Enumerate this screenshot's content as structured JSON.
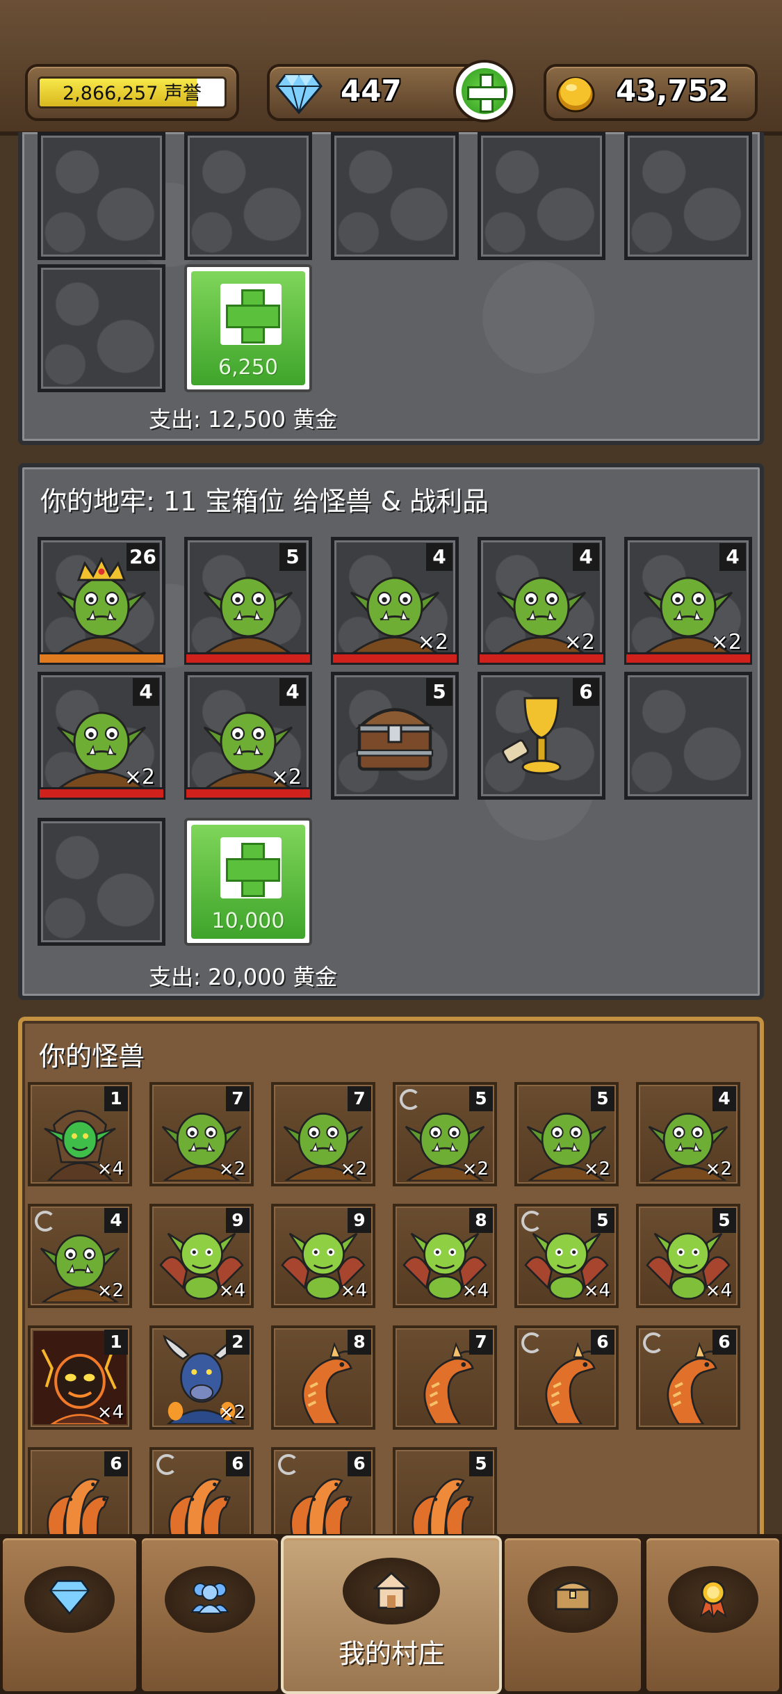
{
  "top_bar": {
    "reputation_text": "2,866,257 声誉",
    "reputation_fill": 0.85,
    "gems": "447",
    "gold": "43,752"
  },
  "panel1": {
    "add_slot_price": "6,250",
    "footer": "支出: 12,500 黄金"
  },
  "panel2": {
    "title": "你的地牢: 11 宝箱位 给怪兽 & 战利品",
    "slots": [
      {
        "num": "26",
        "count": "",
        "type": "orc-king"
      },
      {
        "num": "5",
        "count": "",
        "type": "orc"
      },
      {
        "num": "4",
        "count": "×2",
        "type": "orc"
      },
      {
        "num": "4",
        "count": "×2",
        "type": "orc"
      },
      {
        "num": "4",
        "count": "×2",
        "type": "orc"
      },
      {
        "num": "4",
        "count": "×2",
        "type": "orc"
      },
      {
        "num": "4",
        "count": "×2",
        "type": "orc"
      },
      {
        "num": "5",
        "count": "",
        "type": "chest"
      },
      {
        "num": "6",
        "count": "",
        "type": "goblet"
      }
    ],
    "add_slot_price": "10,000",
    "footer": "支出: 20,000 黄金"
  },
  "monsters": {
    "title": "你的怪兽",
    "items": [
      {
        "num": "1",
        "count": "×4",
        "type": "goblin",
        "refresh": false
      },
      {
        "num": "7",
        "count": "×2",
        "type": "orc",
        "refresh": false
      },
      {
        "num": "7",
        "count": "×2",
        "type": "orc",
        "refresh": false
      },
      {
        "num": "5",
        "count": "×2",
        "type": "orc",
        "refresh": true
      },
      {
        "num": "5",
        "count": "×2",
        "type": "orc",
        "refresh": false
      },
      {
        "num": "4",
        "count": "×2",
        "type": "orc",
        "refresh": false
      },
      {
        "num": "4",
        "count": "×2",
        "type": "orc",
        "refresh": true
      },
      {
        "num": "9",
        "count": "×4",
        "type": "imp",
        "refresh": false
      },
      {
        "num": "9",
        "count": "×4",
        "type": "imp",
        "refresh": false
      },
      {
        "num": "8",
        "count": "×4",
        "type": "imp",
        "refresh": false
      },
      {
        "num": "5",
        "count": "×4",
        "type": "imp",
        "refresh": true
      },
      {
        "num": "5",
        "count": "×4",
        "type": "imp",
        "refresh": false
      },
      {
        "num": "1",
        "count": "×4",
        "type": "fire-demon",
        "refresh": false
      },
      {
        "num": "2",
        "count": "×2",
        "type": "minotaur",
        "refresh": false
      },
      {
        "num": "8",
        "count": "",
        "type": "dragon",
        "refresh": false
      },
      {
        "num": "7",
        "count": "",
        "type": "dragon",
        "refresh": false
      },
      {
        "num": "6",
        "count": "",
        "type": "dragon",
        "refresh": true
      },
      {
        "num": "6",
        "count": "",
        "type": "dragon",
        "refresh": true
      },
      {
        "num": "6",
        "count": "",
        "type": "hydra",
        "refresh": false
      },
      {
        "num": "6",
        "count": "",
        "type": "hydra",
        "refresh": true
      },
      {
        "num": "6",
        "count": "",
        "type": "hydra",
        "refresh": true
      },
      {
        "num": "5",
        "count": "",
        "type": "hydra",
        "refresh": false
      }
    ]
  },
  "nav": {
    "items": [
      {
        "icon": "diamond-icon",
        "label": ""
      },
      {
        "icon": "people-icon",
        "label": ""
      },
      {
        "icon": "house-icon",
        "label": "我的村庄"
      },
      {
        "icon": "chest-icon",
        "label": ""
      },
      {
        "icon": "medal-icon",
        "label": ""
      }
    ]
  }
}
